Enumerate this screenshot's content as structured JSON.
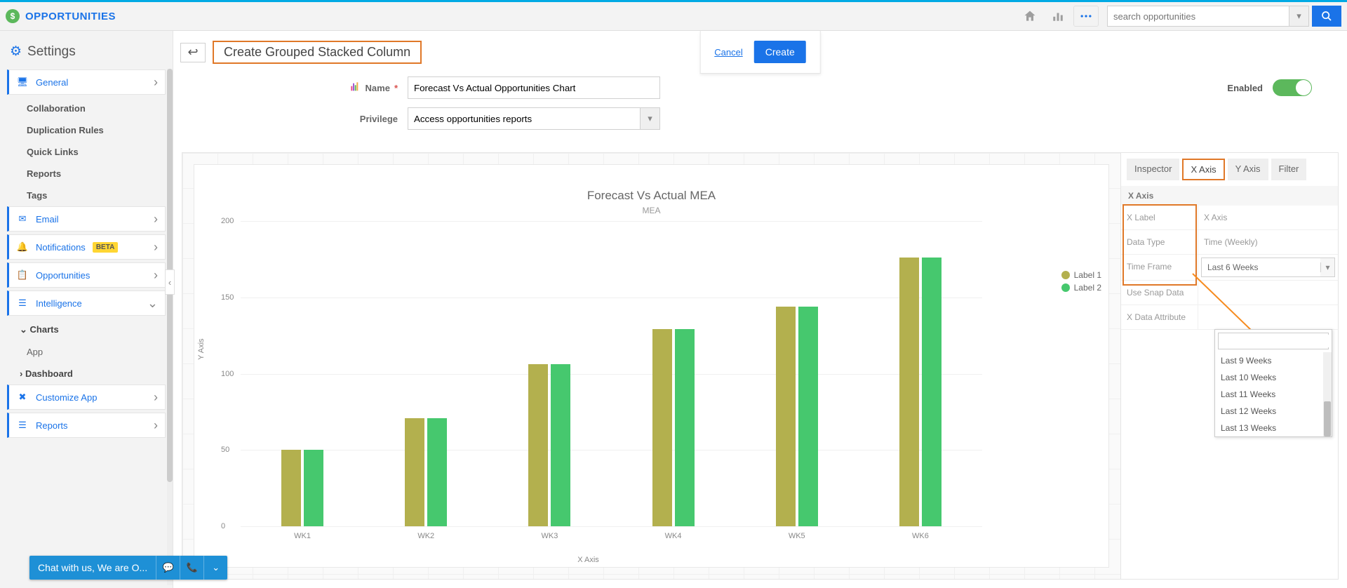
{
  "header": {
    "brand": "OPPORTUNITIES",
    "search_placeholder": "search opportunities"
  },
  "sidebar": {
    "title": "Settings",
    "items": [
      {
        "label": "General",
        "icon": "monitor-icon"
      },
      {
        "label": "Collaboration",
        "sub": true
      },
      {
        "label": "Duplication Rules",
        "sub": true
      },
      {
        "label": "Quick Links",
        "sub": true
      },
      {
        "label": "Reports",
        "sub": true
      },
      {
        "label": "Tags",
        "sub": true
      },
      {
        "label": "Email",
        "icon": "envelope-icon"
      },
      {
        "label": "Notifications",
        "icon": "bell-icon",
        "badge": "BETA"
      },
      {
        "label": "Opportunities",
        "icon": "form-icon"
      },
      {
        "label": "Intelligence",
        "icon": "list-icon",
        "expanded": true
      },
      {
        "label": "Charts",
        "sub2h": true
      },
      {
        "label": "App",
        "sub2": true
      },
      {
        "label": "Dashboard",
        "sub2h": true,
        "collapsed": true
      },
      {
        "label": "Customize App",
        "icon": "wrench-icon"
      },
      {
        "label": "Reports",
        "icon": "list-icon"
      }
    ]
  },
  "page": {
    "title": "Create Grouped Stacked Column",
    "cancel": "Cancel",
    "create": "Create",
    "name_label": "Name",
    "name_value": "Forecast Vs Actual Opportunities Chart",
    "privilege_label": "Privilege",
    "privilege_value": "Access opportunities reports",
    "enabled_label": "Enabled"
  },
  "panel": {
    "tabs": [
      "Inspector",
      "X Axis",
      "Y Axis",
      "Filter"
    ],
    "active_tab": 1,
    "section": "X Axis",
    "rows": {
      "xlabel": {
        "k": "X Label",
        "v": "X Axis"
      },
      "datatype": {
        "k": "Data Type",
        "v": "Time (Weekly)"
      },
      "timeframe": {
        "k": "Time Frame",
        "v": "Last 6 Weeks"
      },
      "snap": {
        "k": "Use Snap Data",
        "v": ""
      },
      "xattr": {
        "k": "X Data Attribute",
        "v": ""
      }
    },
    "dropdown_options": [
      "Last 9 Weeks",
      "Last 10 Weeks",
      "Last 11 Weeks",
      "Last 12 Weeks",
      "Last 13 Weeks"
    ]
  },
  "chart_data": {
    "type": "bar",
    "title": "Forecast Vs Actual MEA",
    "subtitle": "MEA",
    "xlabel": "X Axis",
    "ylabel": "Y Axis",
    "ylim": [
      0,
      200
    ],
    "yticks": [
      0,
      50,
      100,
      150,
      200
    ],
    "categories": [
      "WK1",
      "WK2",
      "WK3",
      "WK4",
      "WK5",
      "WK6"
    ],
    "series": [
      {
        "name": "Label 1",
        "color": "#b3b04e",
        "values": [
          50,
          71,
          106,
          129,
          144,
          176
        ]
      },
      {
        "name": "Label 2",
        "color": "#46c86e",
        "values": [
          50,
          71,
          106,
          129,
          144,
          176
        ]
      }
    ]
  },
  "chat": {
    "text": "Chat with us, We are O..."
  }
}
